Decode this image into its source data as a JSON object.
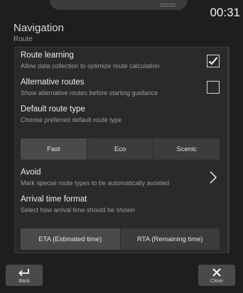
{
  "status": {
    "time": "00:31"
  },
  "header": {
    "title": "Navigation",
    "subtitle": "Route"
  },
  "settings": {
    "route_learning": {
      "title": "Route learning",
      "description": "Allow data collection to optimize route calculation",
      "checked": true
    },
    "alternative_routes": {
      "title": "Alternative routes",
      "description": "Show alternative routes before starting guidance",
      "checked": false
    },
    "default_route_type": {
      "title": "Default route type",
      "description": "Choose preferred default route type",
      "options": [
        "Fast",
        "Eco",
        "Scenic"
      ],
      "selected": "Fast"
    },
    "avoid": {
      "title": "Avoid",
      "description": "Mark special route types to be automatically avoided"
    },
    "arrival_time_format": {
      "title": "Arrival time format",
      "description": "Select how arrival time should be shown",
      "options": [
        "ETA (Estimated time)",
        "RTA (Remaining time)"
      ],
      "selected": "ETA (Estimated time)"
    }
  },
  "footer": {
    "back_label": "Back",
    "close_label": "Close"
  },
  "icons": {
    "back": "back-arrow-icon",
    "close": "close-x-icon",
    "chevron": "chevron-right-icon",
    "check": "checkmark-icon"
  }
}
